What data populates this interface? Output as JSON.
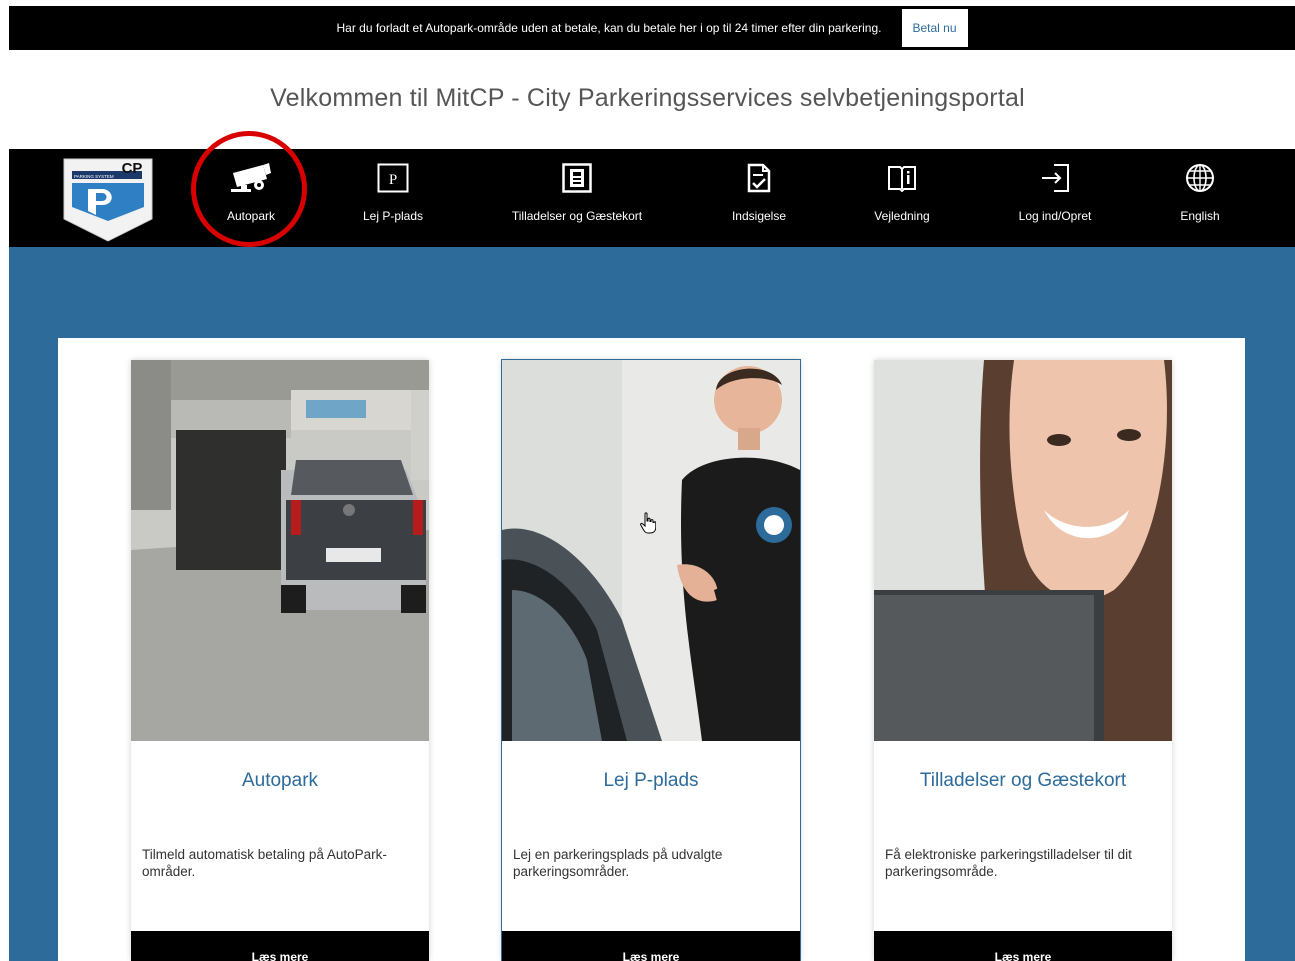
{
  "topbar": {
    "message": "Har du forladt et Autopark-område uden at betale, kan du betale her i op til 24 timer efter din parkering.",
    "pay_button": "Betal nu"
  },
  "welcome_heading": "Velkommen til MitCP - City Parkeringsservices selvbetjeningsportal",
  "logo": {
    "text": "CP",
    "subtext": "PARKING SYSTEM"
  },
  "nav": {
    "items": [
      {
        "label": "Autopark",
        "icon": "camera-icon"
      },
      {
        "label": "Lej P-plads",
        "icon": "parking-sign-icon"
      },
      {
        "label": "Tilladelser og Gæstekort",
        "icon": "permit-card-icon"
      },
      {
        "label": "Indsigelse",
        "icon": "document-check-icon"
      },
      {
        "label": "Vejledning",
        "icon": "book-info-icon"
      },
      {
        "label": "Log ind/Opret",
        "icon": "login-icon"
      },
      {
        "label": "English",
        "icon": "globe-icon"
      }
    ]
  },
  "cards": [
    {
      "title": "Autopark",
      "description": "Tilmeld automatisk betaling på AutoPark-områder.",
      "cta": "Læs mere",
      "image": "car-entering-parking-garage"
    },
    {
      "title": "Lej P-plads",
      "description": "Lej en parkeringsplads på udvalgte parkeringsområder.",
      "cta": "Læs mere",
      "image": "attendant-beside-car"
    },
    {
      "title": "Tilladelser og Gæstekort",
      "description": "Få elektroniske parkeringstilladelser til dit parkeringsområde.",
      "cta": "Læs mere",
      "image": "smiling-woman-at-screen"
    }
  ],
  "colors": {
    "brand_blue": "#2d6b9a",
    "highlight_red": "#d90000",
    "nav_bg": "#000000"
  }
}
